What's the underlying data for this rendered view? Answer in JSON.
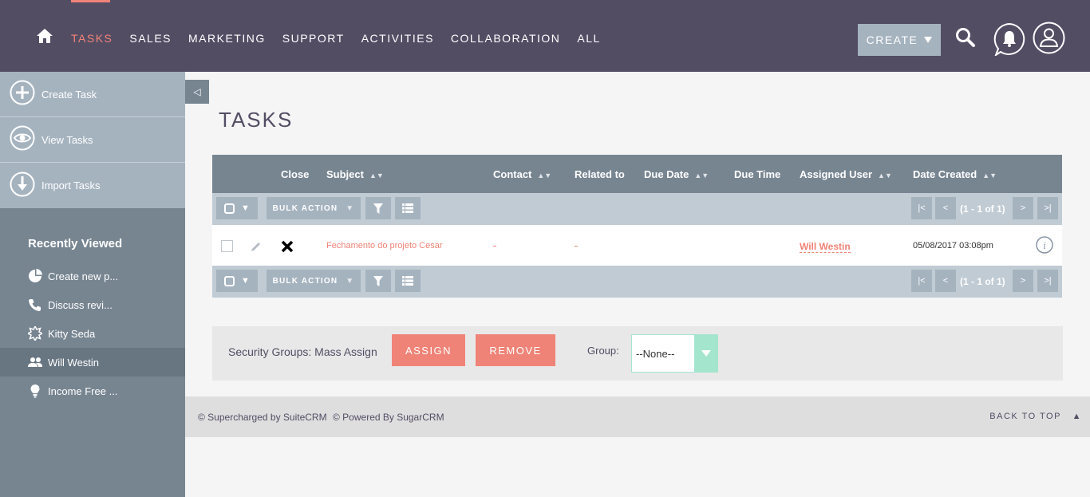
{
  "nav": {
    "items": [
      "TASKS",
      "SALES",
      "MARKETING",
      "SUPPORT",
      "ACTIVITIES",
      "COLLABORATION",
      "ALL"
    ],
    "active": "TASKS",
    "create_label": "CREATE"
  },
  "sidebar": {
    "actions": [
      {
        "label": "Create Task",
        "icon": "plus-circle-icon"
      },
      {
        "label": "View Tasks",
        "icon": "eye-icon"
      },
      {
        "label": "Import Tasks",
        "icon": "download-icon"
      }
    ],
    "recent_title": "Recently Viewed",
    "recent": [
      {
        "label": "Create new p...",
        "icon": "pie-chart-icon"
      },
      {
        "label": "Discuss revi...",
        "icon": "phone-icon"
      },
      {
        "label": "Kitty Seda",
        "icon": "star-badge-icon"
      },
      {
        "label": "Will Westin",
        "icon": "users-icon"
      },
      {
        "label": "Income Free ...",
        "icon": "lightbulb-icon"
      }
    ]
  },
  "page": {
    "title": "TASKS"
  },
  "table": {
    "columns": [
      "Close",
      "Subject",
      "Contact",
      "Related to",
      "Due Date",
      "Due Time",
      "Assigned User",
      "Date Created"
    ],
    "bulk_action": "BULK ACTION",
    "pager": "(1 - 1 of 1)",
    "rows": [
      {
        "subject": "Fechamento do projeto Cesar",
        "contact": "",
        "related_to": "",
        "due_date": "",
        "due_time": "",
        "assigned_user": "Will Westin",
        "date_created": "05/08/2017 03:08pm"
      }
    ]
  },
  "security": {
    "label": "Security Groups: Mass Assign",
    "assign": "ASSIGN",
    "remove": "REMOVE",
    "group_label": "Group:",
    "group_value": "--None--"
  },
  "footer": {
    "suite": "© Supercharged by SuiteCRM",
    "sugar": "© Powered By SugarCRM",
    "back_to_top": "BACK TO TOP"
  },
  "colors": {
    "header": "#534d64",
    "accent": "#f08377",
    "sidebar": "#778591",
    "mint": "#a4e5cd"
  }
}
